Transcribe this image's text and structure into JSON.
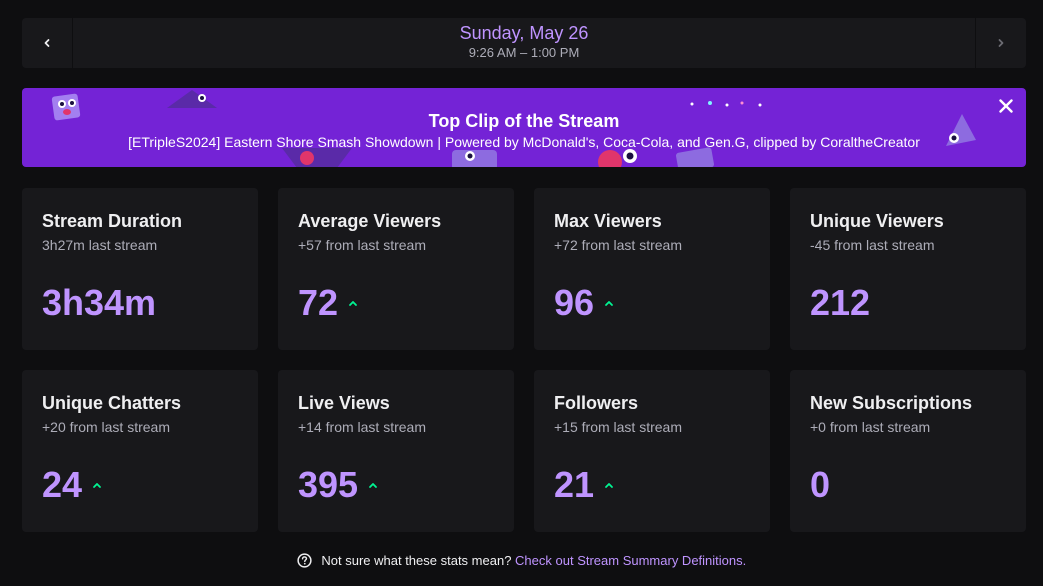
{
  "date_bar": {
    "title": "Sunday, May 26",
    "time_range": "9:26 AM – 1:00 PM",
    "prev_icon": "chevron-left-icon",
    "next_icon": "chevron-right-icon"
  },
  "banner": {
    "title": "Top Clip of the Stream",
    "clip_title": "[ETripleS2024] Eastern Shore Smash Showdown | Powered by McDonald's, Coca-Cola, and Gen.G, clipped by CoraltheCreator",
    "close_icon": "close-icon",
    "background_color": "#7423d6"
  },
  "stats": [
    {
      "title": "Stream Duration",
      "delta": "3h27m last stream",
      "value": "3h34m",
      "trend": ""
    },
    {
      "title": "Average Viewers",
      "delta": "+57 from last stream",
      "value": "72",
      "trend": "up"
    },
    {
      "title": "Max Viewers",
      "delta": "+72 from last stream",
      "value": "96",
      "trend": "up"
    },
    {
      "title": "Unique Viewers",
      "delta": "-45 from last stream",
      "value": "212",
      "trend": ""
    },
    {
      "title": "Unique Chatters",
      "delta": "+20 from last stream",
      "value": "24",
      "trend": "up"
    },
    {
      "title": "Live Views",
      "delta": "+14 from last stream",
      "value": "395",
      "trend": "up"
    },
    {
      "title": "Followers",
      "delta": "+15 from last stream",
      "value": "21",
      "trend": "up"
    },
    {
      "title": "New Subscriptions",
      "delta": "+0 from last stream",
      "value": "0",
      "trend": ""
    }
  ],
  "footer": {
    "question": "Not sure what these stats mean?",
    "link": "Check out Stream Summary Definitions.",
    "help_icon": "question-circle-icon"
  },
  "colors": {
    "background": "#0e0e10",
    "card": "#18181b",
    "accent": "#bf94ff",
    "trend_up": "#00f593"
  }
}
